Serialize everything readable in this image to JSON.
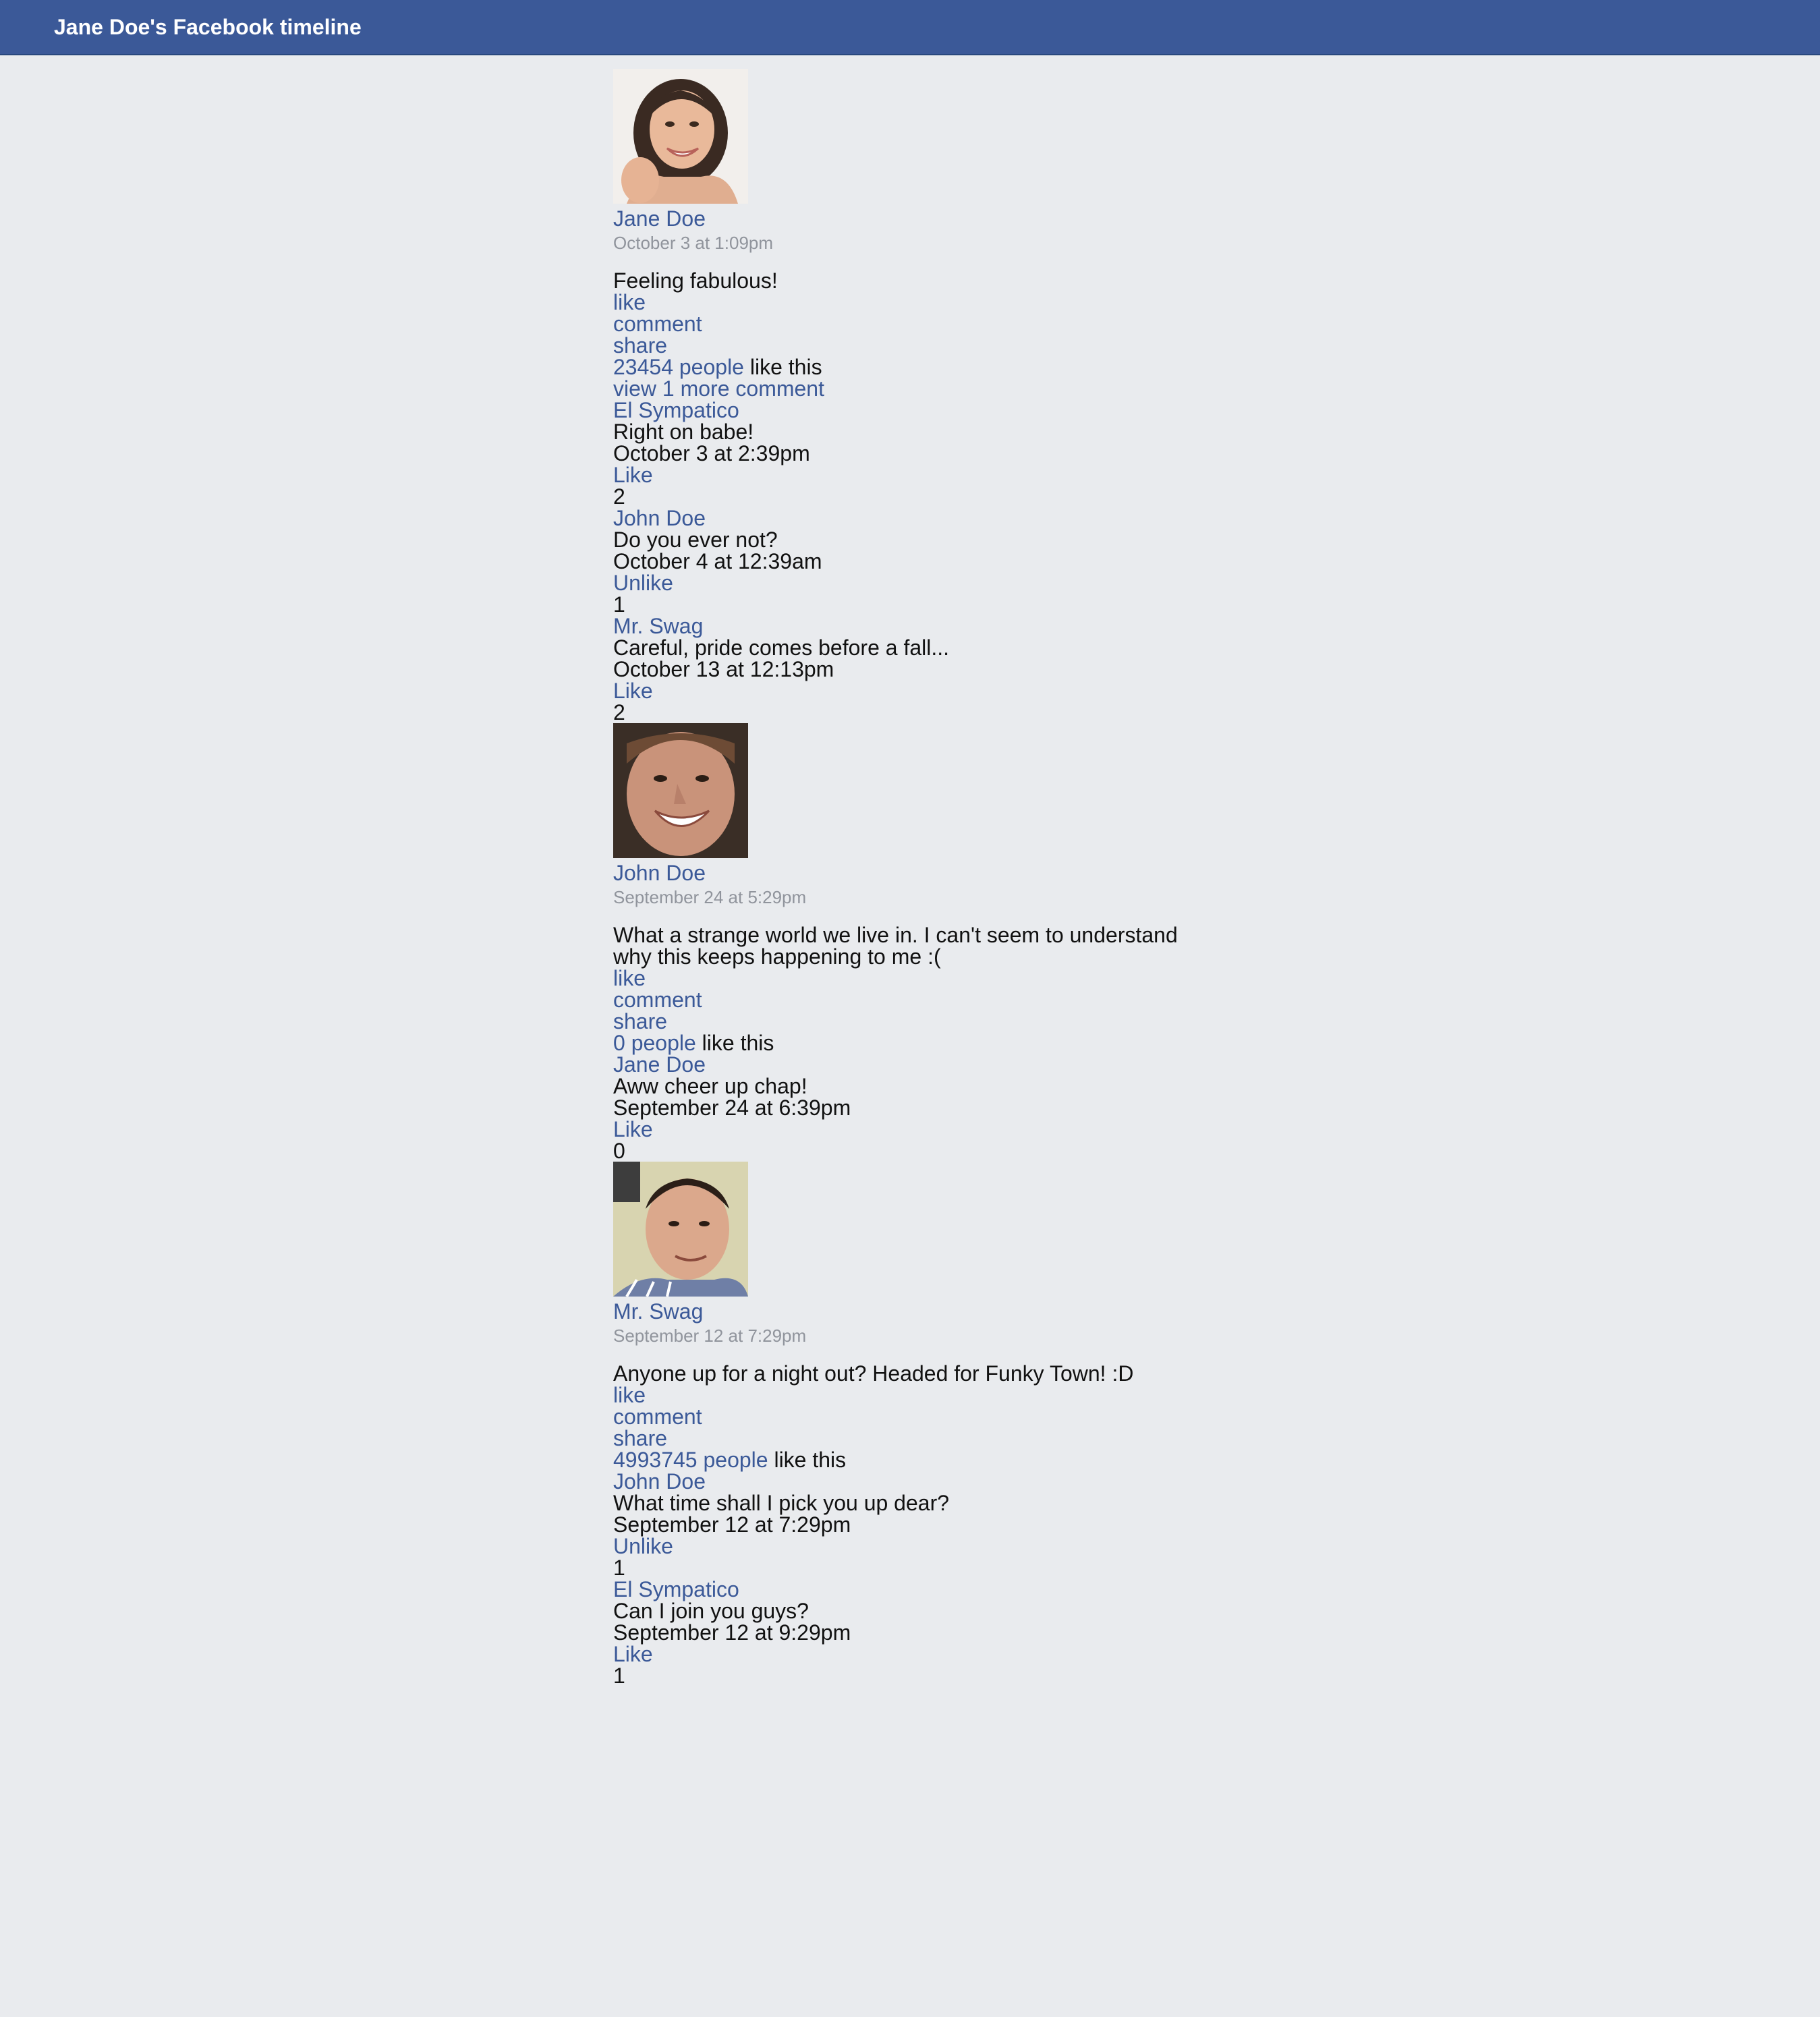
{
  "header": {
    "title": "Jane Doe's Facebook timeline"
  },
  "colors": {
    "header_bg": "#3b5998",
    "link": "#3b5998",
    "page_bg": "#e9ebee",
    "muted": "#90949c"
  },
  "posts": [
    {
      "author": "Jane Doe",
      "time": "October 3 at 1:09pm",
      "text": "Feeling fabulous!",
      "actions": {
        "like": "like",
        "comment": "comment",
        "share": "share"
      },
      "likes_count": "23454 people",
      "likes_suffix": " like this",
      "view_more": "view 1 more comment",
      "comments": [
        {
          "author": "El Sympatico",
          "text": "Right on babe!",
          "time": "October 3 at 2:39pm",
          "like_label": "Like",
          "count": "2"
        },
        {
          "author": "John Doe",
          "text": "Do you ever not?",
          "time": "October 4 at 12:39am",
          "like_label": "Unlike",
          "count": "1"
        },
        {
          "author": "Mr. Swag",
          "text": "Careful, pride comes before a fall...",
          "time": "October 13 at 12:13pm",
          "like_label": "Like",
          "count": "2"
        }
      ]
    },
    {
      "author": "John Doe",
      "time": "September 24 at 5:29pm",
      "text": "What a strange world we live in. I can't seem to understand why this keeps happening to me :(",
      "actions": {
        "like": "like",
        "comment": "comment",
        "share": "share"
      },
      "likes_count": "0 people",
      "likes_suffix": " like this",
      "comments": [
        {
          "author": "Jane Doe",
          "text": "Aww cheer up chap!",
          "time": "September 24 at 6:39pm",
          "like_label": "Like",
          "count": "0"
        }
      ]
    },
    {
      "author": "Mr. Swag",
      "time": "September 12 at 7:29pm",
      "text": "Anyone up for a night out? Headed for Funky Town! :D",
      "actions": {
        "like": "like",
        "comment": "comment",
        "share": "share"
      },
      "likes_count": "4993745 people",
      "likes_suffix": " like this",
      "comments": [
        {
          "author": "John Doe",
          "text": "What time shall I pick you up dear?",
          "time": "September 12 at 7:29pm",
          "like_label": "Unlike",
          "count": "1"
        },
        {
          "author": "El Sympatico",
          "text": "Can I join you guys?",
          "time": "September 12 at 9:29pm",
          "like_label": "Like",
          "count": "1"
        }
      ]
    }
  ]
}
